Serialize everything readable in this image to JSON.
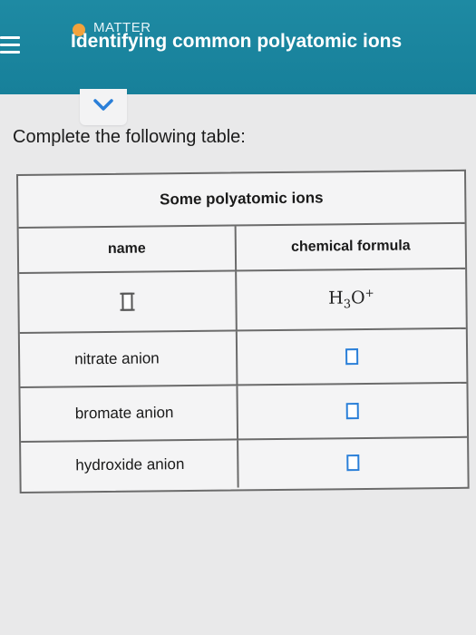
{
  "header": {
    "topic": "MATTER",
    "title": "Identifying common polyatomic ions",
    "accent_color": "#1e8aa3",
    "dot_color": "#f2a23c"
  },
  "toggle": {
    "icon": "chevron-down-icon"
  },
  "prompt": "Complete the following table:",
  "table": {
    "caption": "Some polyatomic ions",
    "col_name": "name",
    "col_formula": "chemical formula",
    "rows": [
      {
        "name": "",
        "formula": {
          "el1": "H",
          "n1": "3",
          "el2": "O",
          "charge": "+"
        }
      },
      {
        "name": "nitrate anion",
        "formula": null
      },
      {
        "name": "bromate anion",
        "formula": null
      },
      {
        "name": "hydroxide anion",
        "formula": null
      }
    ]
  }
}
